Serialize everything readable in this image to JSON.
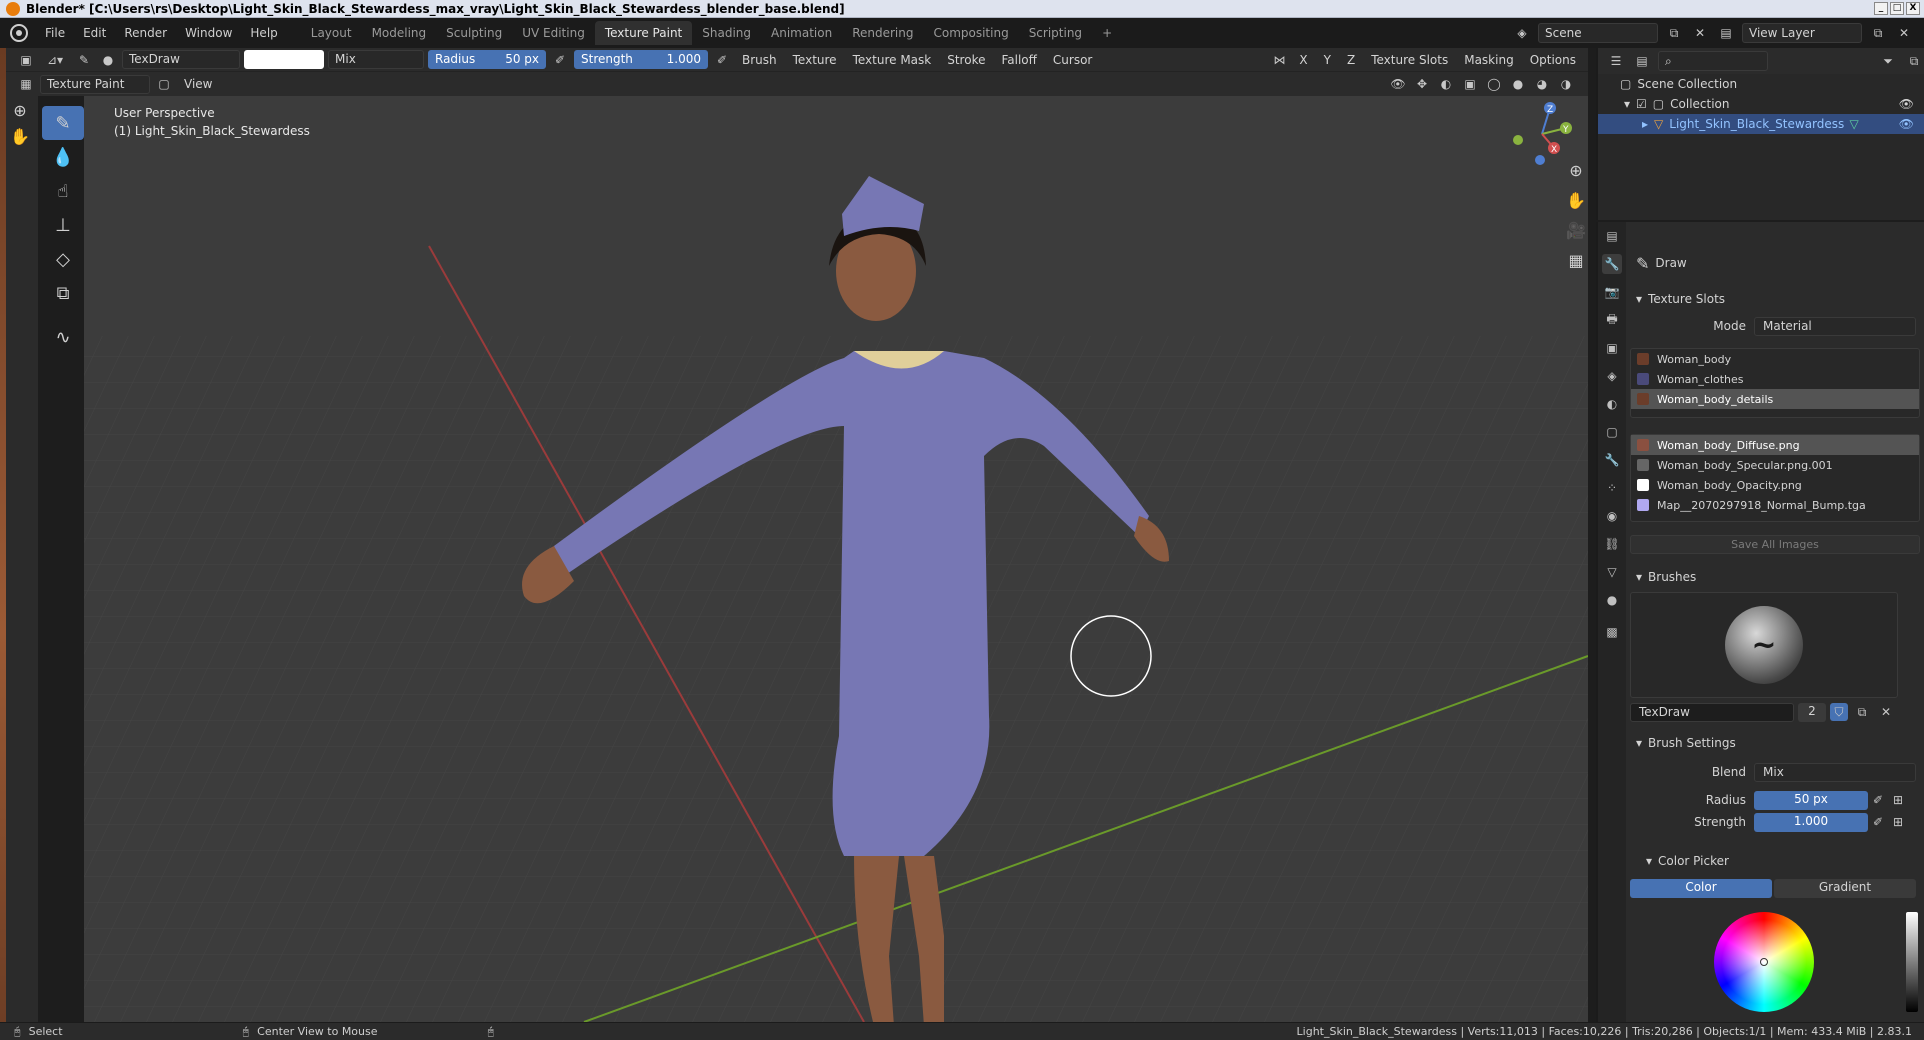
{
  "window": {
    "title": "Blender* [C:\\Users\\rs\\Desktop\\Light_Skin_Black_Stewardess_max_vray\\Light_Skin_Black_Stewardess_blender_base.blend]",
    "controls": [
      "_",
      "□",
      "X"
    ]
  },
  "menu": {
    "items": [
      "File",
      "Edit",
      "Render",
      "Window",
      "Help"
    ]
  },
  "workspaces": {
    "tabs": [
      "Layout",
      "Modeling",
      "Sculpting",
      "UV Editing",
      "Texture Paint",
      "Shading",
      "Animation",
      "Rendering",
      "Compositing",
      "Scripting"
    ],
    "active": "Texture Paint",
    "add": "+"
  },
  "scene": {
    "name": "Scene",
    "view_layer": "View Layer"
  },
  "tool_header": {
    "brush_name": "TexDraw",
    "blend_mode": "Mix",
    "radius_label": "Radius",
    "radius_value": "50 px",
    "strength_label": "Strength",
    "strength_value": "1.000",
    "menus": [
      "Brush",
      "Texture",
      "Texture Mask",
      "Stroke",
      "Falloff",
      "Cursor"
    ],
    "axes": [
      "X",
      "Y",
      "Z"
    ],
    "right_menus": [
      "Texture Slots",
      "Masking",
      "Options"
    ],
    "brush_color": "#ffffff"
  },
  "editor_header": {
    "mode": "Texture Paint",
    "view_menu": "View"
  },
  "viewport": {
    "perspective": "User Perspective",
    "object_label": "(1) Light_Skin_Black_Stewardess",
    "gizmo_axes": [
      "Z",
      "Y",
      "X"
    ],
    "colors": {
      "background": "#3c3c3c",
      "x_axis": "#9a3b3b",
      "y_axis": "#6a9a2a",
      "suit": "#7777b4",
      "scarf": "#e0cf9a",
      "skin": "#8a5a40"
    }
  },
  "outliner": {
    "root": "Scene Collection",
    "collection": "Collection",
    "object": "Light_Skin_Black_Stewardess"
  },
  "properties": {
    "tool_name": "Draw",
    "texture_slots": {
      "title": "Texture Slots",
      "mode_label": "Mode",
      "mode_value": "Material",
      "materials": [
        "Woman_body",
        "Woman_clothes",
        "Woman_body_details"
      ],
      "selected_material": "Woman_body_details",
      "images": [
        "Woman_body_Diffuse.png",
        "Woman_body_Specular.png.001",
        "Woman_body_Opacity.png",
        "Map__2070297918_Normal_Bump.tga"
      ],
      "selected_image": "Woman_body_Diffuse.png",
      "save_all": "Save All Images"
    },
    "brushes": {
      "title": "Brushes",
      "brush_name": "TexDraw",
      "users": "2"
    },
    "brush_settings": {
      "title": "Brush Settings",
      "blend_label": "Blend",
      "blend_value": "Mix",
      "radius_label": "Radius",
      "radius_value": "50 px",
      "strength_label": "Strength",
      "strength_value": "1.000"
    },
    "color_picker": {
      "title": "Color Picker",
      "tabs": [
        "Color",
        "Gradient"
      ],
      "active_tab": "Color"
    }
  },
  "statusbar": {
    "select": "Select",
    "center_view": "Center View to Mouse",
    "stats": "Light_Skin_Black_Stewardess | Verts:11,013 | Faces:10,226 | Tris:20,286 | Objects:1/1 | Mem: 433.4 MiB | 2.83.1"
  }
}
